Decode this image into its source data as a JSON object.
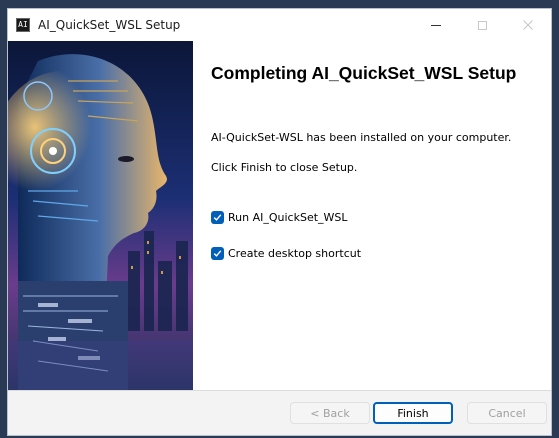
{
  "window": {
    "title": "AI_QuickSet_WSL Setup",
    "app_icon_glyph": "AI"
  },
  "icons": {
    "app": "app-icon",
    "minimize": "minimize-icon",
    "maximize": "maximize-icon",
    "close": "close-icon",
    "check": "checkmark-icon"
  },
  "main": {
    "heading": "Completing AI_QuickSet_WSL Setup",
    "installed_text": "AI-QuickSet-WSL has been installed on your computer.",
    "instruction_text": "Click Finish to close Setup.",
    "options": [
      {
        "label": "Run AI_QuickSet_WSL",
        "checked": true
      },
      {
        "label": "Create desktop shortcut",
        "checked": true
      }
    ]
  },
  "buttons": {
    "back": "< Back",
    "finish": "Finish",
    "cancel": "Cancel"
  },
  "colors": {
    "accent": "#005fb8",
    "disabled_text": "#a0a0a0"
  }
}
